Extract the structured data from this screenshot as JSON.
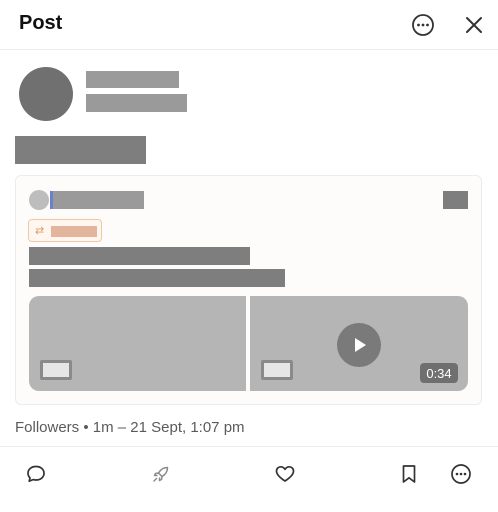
{
  "header": {
    "title": "Post",
    "more_icon": "more-horizontal-circle-icon",
    "close_icon": "close-icon"
  },
  "post": {
    "meta_text": "Followers • 1m – 21 Sept, 1:07 pm"
  },
  "shared_card": {
    "chip_icon": "repost-icon",
    "video_duration": "0:34",
    "play_icon": "play-icon",
    "thumb_icon": "image-thumbnail-icon"
  },
  "actions": {
    "comment_icon": "comment-icon",
    "boost_icon": "rocket-icon",
    "like_icon": "heart-icon",
    "bookmark_icon": "bookmark-icon",
    "more_icon": "more-horizontal-circle-icon"
  },
  "colors": {
    "redaction_gray": "#9a9a9a",
    "chip_border": "#f0c9a3",
    "chip_fill": "#e2b59c"
  }
}
